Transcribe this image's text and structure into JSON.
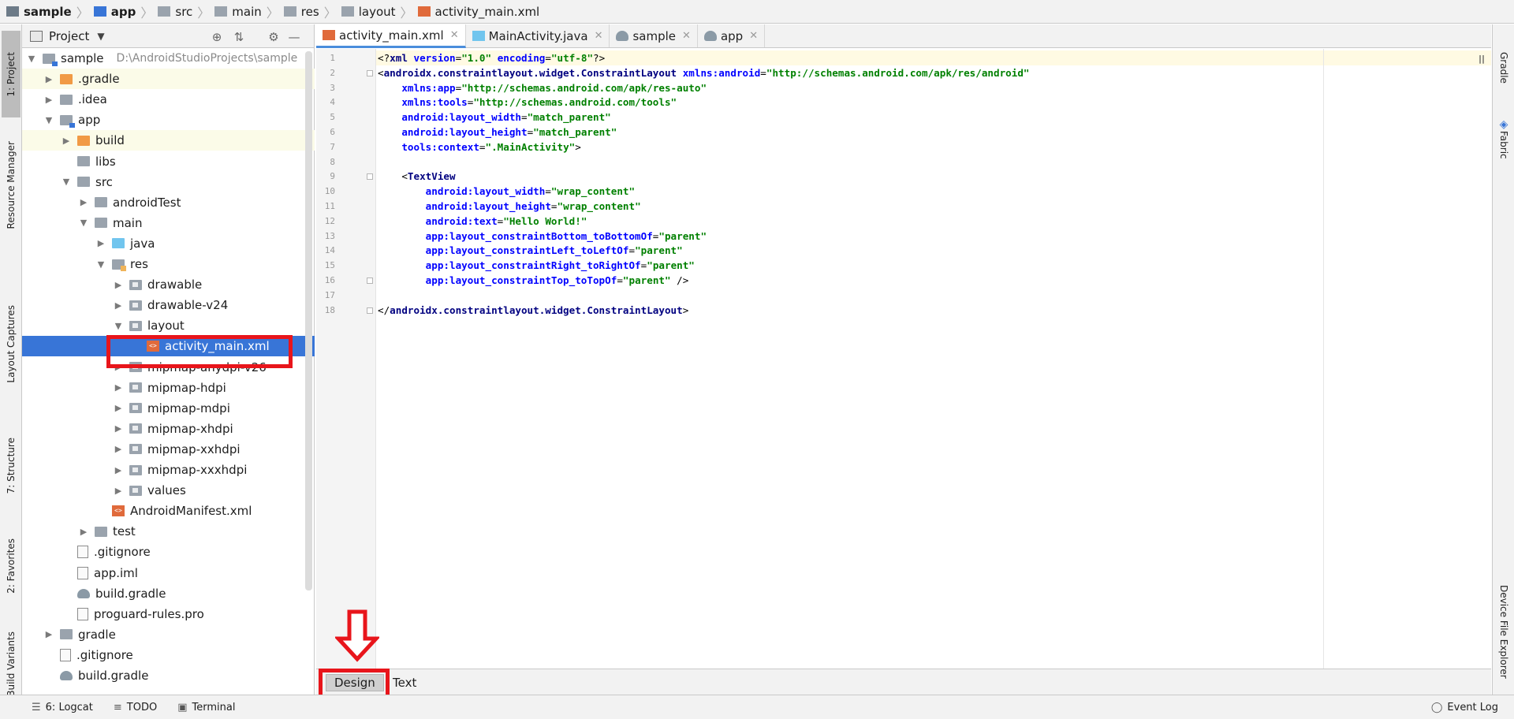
{
  "breadcrumb": [
    {
      "label": "sample",
      "bold": true
    },
    {
      "label": "app",
      "bold": true
    },
    {
      "label": "src",
      "bold": false
    },
    {
      "label": "main",
      "bold": false
    },
    {
      "label": "res",
      "bold": false
    },
    {
      "label": "layout",
      "bold": false
    },
    {
      "label": "activity_main.xml",
      "bold": false
    }
  ],
  "left_strip": {
    "project": "1: Project",
    "resource_manager": "Resource Manager",
    "layout_captures": "Layout Captures",
    "structure": "7: Structure",
    "favorites": "2: Favorites",
    "build_variants": "Build Variants"
  },
  "right_strip": {
    "gradle": "Gradle",
    "fabric": "Fabric",
    "device_file_explorer": "Device File Explorer"
  },
  "project_panel": {
    "title": "Project",
    "tree": [
      {
        "label": "sample",
        "hint": "D:\\AndroidStudioProjects\\sample",
        "depth": 0,
        "arrow": "down",
        "icon": "mod"
      },
      {
        "label": ".gradle",
        "depth": 1,
        "arrow": "right",
        "icon": "orange",
        "hl": true
      },
      {
        "label": ".idea",
        "depth": 1,
        "arrow": "right",
        "icon": "gray"
      },
      {
        "label": "app",
        "depth": 1,
        "arrow": "down",
        "icon": "mod"
      },
      {
        "label": "build",
        "depth": 2,
        "arrow": "right",
        "icon": "orange",
        "hl": true
      },
      {
        "label": "libs",
        "depth": 2,
        "arrow": "none",
        "icon": "gray"
      },
      {
        "label": "src",
        "depth": 2,
        "arrow": "down",
        "icon": "gray"
      },
      {
        "label": "androidTest",
        "depth": 3,
        "arrow": "right",
        "icon": "gray"
      },
      {
        "label": "main",
        "depth": 3,
        "arrow": "down",
        "icon": "gray"
      },
      {
        "label": "java",
        "depth": 4,
        "arrow": "right",
        "icon": "blue"
      },
      {
        "label": "res",
        "depth": 4,
        "arrow": "down",
        "icon": "res"
      },
      {
        "label": "drawable",
        "depth": 5,
        "arrow": "right",
        "icon": "pkg"
      },
      {
        "label": "drawable-v24",
        "depth": 5,
        "arrow": "right",
        "icon": "pkg"
      },
      {
        "label": "layout",
        "depth": 5,
        "arrow": "down",
        "icon": "pkg"
      },
      {
        "label": "activity_main.xml",
        "depth": 6,
        "arrow": "none",
        "icon": "xml",
        "selected": true
      },
      {
        "label": "mipmap-anydpi-v26",
        "depth": 5,
        "arrow": "right",
        "icon": "pkg"
      },
      {
        "label": "mipmap-hdpi",
        "depth": 5,
        "arrow": "right",
        "icon": "pkg"
      },
      {
        "label": "mipmap-mdpi",
        "depth": 5,
        "arrow": "right",
        "icon": "pkg"
      },
      {
        "label": "mipmap-xhdpi",
        "depth": 5,
        "arrow": "right",
        "icon": "pkg"
      },
      {
        "label": "mipmap-xxhdpi",
        "depth": 5,
        "arrow": "right",
        "icon": "pkg"
      },
      {
        "label": "mipmap-xxxhdpi",
        "depth": 5,
        "arrow": "right",
        "icon": "pkg"
      },
      {
        "label": "values",
        "depth": 5,
        "arrow": "right",
        "icon": "pkg"
      },
      {
        "label": "AndroidManifest.xml",
        "depth": 4,
        "arrow": "none",
        "icon": "xml"
      },
      {
        "label": "test",
        "depth": 3,
        "arrow": "right",
        "icon": "gray"
      },
      {
        "label": ".gitignore",
        "depth": 2,
        "arrow": "none",
        "icon": "file"
      },
      {
        "label": "app.iml",
        "depth": 2,
        "arrow": "none",
        "icon": "file"
      },
      {
        "label": "build.gradle",
        "depth": 2,
        "arrow": "none",
        "icon": "gradle"
      },
      {
        "label": "proguard-rules.pro",
        "depth": 2,
        "arrow": "none",
        "icon": "file"
      },
      {
        "label": "gradle",
        "depth": 1,
        "arrow": "right",
        "icon": "gray"
      },
      {
        "label": ".gitignore",
        "depth": 1,
        "arrow": "none",
        "icon": "file"
      },
      {
        "label": "build.gradle",
        "depth": 1,
        "arrow": "none",
        "icon": "gradle"
      }
    ]
  },
  "editor_tabs": [
    {
      "label": "activity_main.xml",
      "active": true,
      "icon": "xml"
    },
    {
      "label": "MainActivity.java",
      "active": false,
      "icon": "java"
    },
    {
      "label": "sample",
      "active": false,
      "icon": "gradle"
    },
    {
      "label": "app",
      "active": false,
      "icon": "gradle"
    }
  ],
  "code_lines": [
    [
      [
        "pl",
        "<?"
      ],
      [
        "tag",
        "xml "
      ],
      [
        "attr",
        "version"
      ],
      [
        "pl",
        "="
      ],
      [
        "val",
        "\"1.0\""
      ],
      [
        "pl",
        " "
      ],
      [
        "attr",
        "encoding"
      ],
      [
        "pl",
        "="
      ],
      [
        "val",
        "\"utf-8\""
      ],
      [
        "pl",
        "?>"
      ]
    ],
    [
      [
        "pl",
        "<"
      ],
      [
        "tag",
        "androidx.constraintlayout.widget.ConstraintLayout "
      ],
      [
        "attr",
        "xmlns:android"
      ],
      [
        "pl",
        "="
      ],
      [
        "val",
        "\"http://schemas.android.com/apk/res/android\""
      ]
    ],
    [
      [
        "pl",
        "    "
      ],
      [
        "attr",
        "xmlns:app"
      ],
      [
        "pl",
        "="
      ],
      [
        "val",
        "\"http://schemas.android.com/apk/res-auto\""
      ]
    ],
    [
      [
        "pl",
        "    "
      ],
      [
        "attr",
        "xmlns:tools"
      ],
      [
        "pl",
        "="
      ],
      [
        "val",
        "\"http://schemas.android.com/tools\""
      ]
    ],
    [
      [
        "pl",
        "    "
      ],
      [
        "attr",
        "android:layout_width"
      ],
      [
        "pl",
        "="
      ],
      [
        "val",
        "\"match_parent\""
      ]
    ],
    [
      [
        "pl",
        "    "
      ],
      [
        "attr",
        "android:layout_height"
      ],
      [
        "pl",
        "="
      ],
      [
        "val",
        "\"match_parent\""
      ]
    ],
    [
      [
        "pl",
        "    "
      ],
      [
        "attr",
        "tools:context"
      ],
      [
        "pl",
        "="
      ],
      [
        "val",
        "\".MainActivity\""
      ],
      [
        "pl",
        ">"
      ]
    ],
    [
      [
        "pl",
        ""
      ]
    ],
    [
      [
        "pl",
        "    <"
      ],
      [
        "tag",
        "TextView"
      ]
    ],
    [
      [
        "pl",
        "        "
      ],
      [
        "attr",
        "android:layout_width"
      ],
      [
        "pl",
        "="
      ],
      [
        "val",
        "\"wrap_content\""
      ]
    ],
    [
      [
        "pl",
        "        "
      ],
      [
        "attr",
        "android:layout_height"
      ],
      [
        "pl",
        "="
      ],
      [
        "val",
        "\"wrap_content\""
      ]
    ],
    [
      [
        "pl",
        "        "
      ],
      [
        "attr",
        "android:text"
      ],
      [
        "pl",
        "="
      ],
      [
        "val",
        "\"Hello World!\""
      ]
    ],
    [
      [
        "pl",
        "        "
      ],
      [
        "attr",
        "app:layout_constraintBottom_toBottomOf"
      ],
      [
        "pl",
        "="
      ],
      [
        "val",
        "\"parent\""
      ]
    ],
    [
      [
        "pl",
        "        "
      ],
      [
        "attr",
        "app:layout_constraintLeft_toLeftOf"
      ],
      [
        "pl",
        "="
      ],
      [
        "val",
        "\"parent\""
      ]
    ],
    [
      [
        "pl",
        "        "
      ],
      [
        "attr",
        "app:layout_constraintRight_toRightOf"
      ],
      [
        "pl",
        "="
      ],
      [
        "val",
        "\"parent\""
      ]
    ],
    [
      [
        "pl",
        "        "
      ],
      [
        "attr",
        "app:layout_constraintTop_toTopOf"
      ],
      [
        "pl",
        "="
      ],
      [
        "val",
        "\"parent\""
      ],
      [
        "pl",
        " />"
      ]
    ],
    [
      [
        "pl",
        ""
      ]
    ],
    [
      [
        "pl",
        "</"
      ],
      [
        "tag",
        "androidx.constraintlayout.widget.ConstraintLayout"
      ],
      [
        "pl",
        ">"
      ]
    ]
  ],
  "line_numbers": [
    "1",
    "2",
    "3",
    "4",
    "5",
    "6",
    "7",
    "8",
    "9",
    "10",
    "11",
    "12",
    "13",
    "14",
    "15",
    "16",
    "17",
    "18"
  ],
  "editor_mode_tabs": {
    "design": "Design",
    "text": "Text"
  },
  "status_bar": {
    "logcat": "6: Logcat",
    "todo": "TODO",
    "terminal": "Terminal",
    "event_log": "Event Log"
  },
  "colors": {
    "selection": "#3875d7",
    "annotation": "#e8151b",
    "xml_tag": "#000080",
    "xml_attr": "#0000ff",
    "xml_value": "#008000"
  }
}
